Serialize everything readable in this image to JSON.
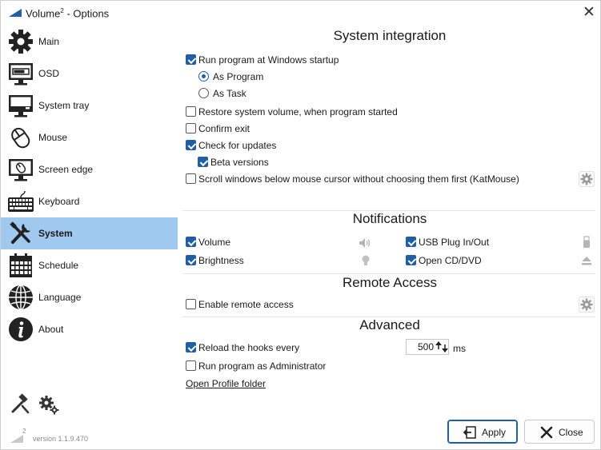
{
  "window": {
    "title": "Volume",
    "title_sup": "2",
    "title_suffix": " - Options"
  },
  "sidebar": {
    "items": [
      {
        "label": "Main",
        "icon": "gear-icon"
      },
      {
        "label": "OSD",
        "icon": "monitor-osd-icon"
      },
      {
        "label": "System tray",
        "icon": "monitor-tray-icon"
      },
      {
        "label": "Mouse",
        "icon": "mouse-icon"
      },
      {
        "label": "Screen edge",
        "icon": "screen-edge-icon"
      },
      {
        "label": "Keyboard",
        "icon": "keyboard-icon"
      },
      {
        "label": "System",
        "icon": "tools-icon"
      },
      {
        "label": "Schedule",
        "icon": "calendar-icon"
      },
      {
        "label": "Language",
        "icon": "globe-icon"
      },
      {
        "label": "About",
        "icon": "info-icon"
      }
    ],
    "selected": "System",
    "version_sup": "2",
    "version": "version 1.1.9.470"
  },
  "system_integration": {
    "title": "System integration",
    "run_at_startup": {
      "label": "Run program at Windows startup",
      "checked": true
    },
    "as_program": {
      "label": "As Program",
      "checked": true
    },
    "as_task": {
      "label": "As Task",
      "checked": false
    },
    "restore_volume": {
      "label": "Restore system volume, when program started",
      "checked": false
    },
    "confirm_exit": {
      "label": "Confirm exit",
      "checked": false
    },
    "check_updates": {
      "label": "Check for updates",
      "checked": true
    },
    "beta_versions": {
      "label": "Beta versions",
      "checked": true
    },
    "scroll_windows": {
      "label": "Scroll windows below mouse cursor without choosing them first (KatMouse)",
      "checked": false
    }
  },
  "notifications": {
    "title": "Notifications",
    "volume": {
      "label": "Volume",
      "checked": true,
      "icon": "speaker-icon"
    },
    "brightness": {
      "label": "Brightness",
      "checked": true,
      "icon": "bulb-icon"
    },
    "usb": {
      "label": "USB Plug In/Out",
      "checked": true,
      "icon": "usb-icon"
    },
    "cd": {
      "label": "Open CD/DVD",
      "checked": true,
      "icon": "eject-icon"
    }
  },
  "remote_access": {
    "title": "Remote Access",
    "enable": {
      "label": "Enable remote access",
      "checked": false
    }
  },
  "advanced": {
    "title": "Advanced",
    "reload_hooks": {
      "label": "Reload the hooks every",
      "checked": true,
      "value": "500",
      "unit": "ms"
    },
    "run_admin": {
      "label": "Run program as Administrator",
      "checked": false
    },
    "open_profile": "Open Profile folder"
  },
  "buttons": {
    "apply": "Apply",
    "close": "Close"
  },
  "colors": {
    "accent": "#1f5fa8",
    "selection": "#9fc9ee"
  }
}
